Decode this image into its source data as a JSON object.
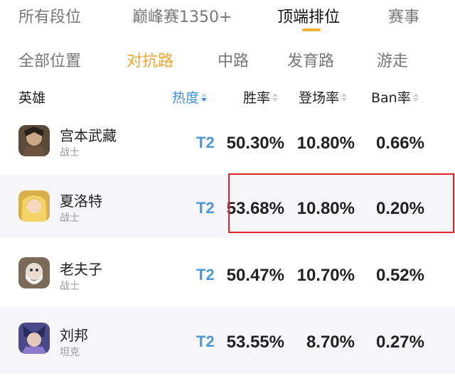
{
  "top_tabs": [
    {
      "label": "所有段位"
    },
    {
      "label": "巅峰赛1350+"
    },
    {
      "label": "顶端排位"
    },
    {
      "label": "赛事"
    }
  ],
  "active_top_tab": "顶端排位",
  "position_tabs": [
    {
      "label": "全部位置"
    },
    {
      "label": "对抗路"
    },
    {
      "label": "中路"
    },
    {
      "label": "发育路"
    },
    {
      "label": "游走"
    }
  ],
  "active_position_tab": "对抗路",
  "header": {
    "hero": "英雄",
    "heat": "热度",
    "win_rate": "胜率",
    "pick_rate": "登场率",
    "ban_rate": "Ban率"
  },
  "sorted_column": "热度",
  "rows": [
    {
      "name": "宫本武藏",
      "role": "战士",
      "tier": "T2",
      "win_rate": "50.30%",
      "pick_rate": "10.80%",
      "ban_rate": "0.66%"
    },
    {
      "name": "夏洛特",
      "role": "战士",
      "tier": "T2",
      "win_rate": "53.68%",
      "pick_rate": "10.80%",
      "ban_rate": "0.20%"
    },
    {
      "name": "老夫子",
      "role": "战士",
      "tier": "T2",
      "win_rate": "50.47%",
      "pick_rate": "10.70%",
      "ban_rate": "0.52%"
    },
    {
      "name": "刘邦",
      "role": "坦克",
      "tier": "T2",
      "win_rate": "53.55%",
      "pick_rate": "8.70%",
      "ban_rate": "0.27%"
    }
  ],
  "highlighted_row": "夏洛特",
  "colors": {
    "accent_orange": "#f2a52e",
    "tier_blue": "#4a97da",
    "highlight_red": "#e0262b"
  }
}
